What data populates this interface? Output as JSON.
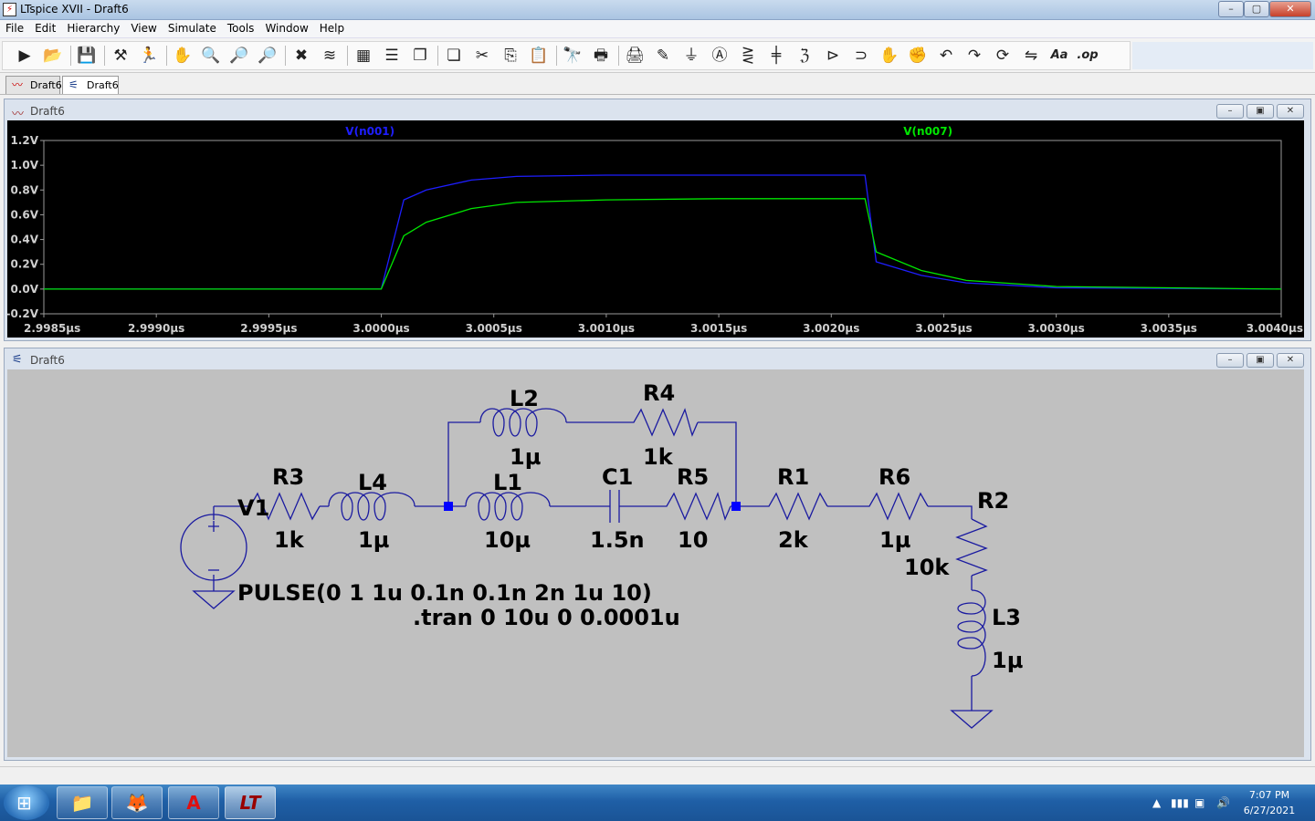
{
  "app": {
    "title": "LTspice XVII - Draft6"
  },
  "window_controls": {
    "minimize": "–",
    "maximize": "▢",
    "close": "✕"
  },
  "menu": [
    "File",
    "Edit",
    "Hierarchy",
    "View",
    "Simulate",
    "Tools",
    "Window",
    "Help"
  ],
  "toolbar": {
    "buttons": [
      {
        "name": "run-icon",
        "glyph": "▶"
      },
      {
        "name": "open-icon",
        "glyph": "📂"
      },
      {
        "name": "save-icon",
        "glyph": "💾"
      },
      {
        "name": "control-panel-icon",
        "glyph": "⚒"
      },
      {
        "name": "run-probe-icon",
        "glyph": "🏃"
      },
      {
        "name": "pan-hand-icon",
        "glyph": "✋"
      },
      {
        "name": "zoom-in-icon",
        "glyph": "🔍"
      },
      {
        "name": "zoom-area-icon",
        "glyph": "🔎"
      },
      {
        "name": "zoom-out-icon",
        "glyph": "🔎"
      },
      {
        "name": "zoom-fit-icon",
        "glyph": "✖"
      },
      {
        "name": "autorange-icon",
        "glyph": "≋"
      },
      {
        "name": "grid-icon",
        "glyph": "▦"
      },
      {
        "name": "tile-horizontal-icon",
        "glyph": "☰"
      },
      {
        "name": "cascade-icon",
        "glyph": "❐"
      },
      {
        "name": "tile-vertical-icon",
        "glyph": "❏"
      },
      {
        "name": "cut-icon",
        "glyph": "✂"
      },
      {
        "name": "copy-icon",
        "glyph": "⎘"
      },
      {
        "name": "paste-icon",
        "glyph": "📋"
      },
      {
        "name": "find-icon",
        "glyph": "🔭"
      },
      {
        "name": "print-icon",
        "glyph": "🖶"
      },
      {
        "name": "print-setup-icon",
        "glyph": "🖨"
      },
      {
        "name": "draw-wire-icon",
        "glyph": "✎"
      },
      {
        "name": "ground-icon",
        "glyph": "⏚"
      },
      {
        "name": "label-net-icon",
        "glyph": "Ⓐ"
      },
      {
        "name": "resistor-icon",
        "glyph": "⋛"
      },
      {
        "name": "capacitor-icon",
        "glyph": "╪"
      },
      {
        "name": "inductor-icon",
        "glyph": "ℨ"
      },
      {
        "name": "diode-icon",
        "glyph": "⊳"
      },
      {
        "name": "component-icon",
        "glyph": "⊃"
      },
      {
        "name": "move-icon",
        "glyph": "✋"
      },
      {
        "name": "drag-icon",
        "glyph": "✊"
      },
      {
        "name": "undo-icon",
        "glyph": "↶"
      },
      {
        "name": "redo-icon",
        "glyph": "↷"
      },
      {
        "name": "rotate-icon",
        "glyph": "⟳"
      },
      {
        "name": "mirror-icon",
        "glyph": "⇋"
      },
      {
        "name": "text-icon",
        "glyph": "Aa"
      },
      {
        "name": "spice-directive-icon",
        "glyph": ".op"
      }
    ]
  },
  "tabs": [
    {
      "label": "Draft6",
      "icon": "waveform-icon",
      "active": false
    },
    {
      "label": "Draft6",
      "icon": "schematic-icon",
      "active": true
    }
  ],
  "plot_window": {
    "title": "Draft6",
    "trace_labels": [
      {
        "text": "V(n001)",
        "color": "#1e1eff"
      },
      {
        "text": "V(n007)",
        "color": "#00e600"
      }
    ]
  },
  "chart_data": {
    "type": "line",
    "title": "",
    "xlabel": "",
    "ylabel": "",
    "xlim": [
      2.9985,
      3.004
    ],
    "ylim": [
      -0.2,
      1.2
    ],
    "grid": false,
    "legend": "top",
    "x_ticks": [
      "2.9985µs",
      "2.9990µs",
      "2.9995µs",
      "3.0000µs",
      "3.0005µs",
      "3.0010µs",
      "3.0015µs",
      "3.0020µs",
      "3.0025µs",
      "3.0030µs",
      "3.0035µs",
      "3.0040µs"
    ],
    "y_ticks": [
      "1.2V",
      "1.0V",
      "0.8V",
      "0.6V",
      "0.4V",
      "0.2V",
      "0.0V",
      "-0.2V"
    ],
    "y_tick_values": [
      1.2,
      1.0,
      0.8,
      0.6,
      0.4,
      0.2,
      0.0,
      -0.2
    ],
    "series": [
      {
        "name": "V(n001)",
        "color": "#1e1eff",
        "x": [
          2.9985,
          3.0,
          3.0001,
          3.0002,
          3.0004,
          3.0006,
          3.001,
          3.0015,
          3.0021,
          3.00215,
          3.0022,
          3.0024,
          3.0026,
          3.003,
          3.004
        ],
        "y": [
          0.0,
          0.0,
          0.72,
          0.8,
          0.88,
          0.91,
          0.92,
          0.92,
          0.92,
          0.92,
          0.22,
          0.11,
          0.05,
          0.01,
          0.0
        ]
      },
      {
        "name": "V(n007)",
        "color": "#00e600",
        "x": [
          2.9985,
          3.0,
          3.0001,
          3.0002,
          3.0004,
          3.0006,
          3.001,
          3.0015,
          3.0021,
          3.00215,
          3.0022,
          3.0024,
          3.0026,
          3.003,
          3.004
        ],
        "y": [
          0.0,
          0.0,
          0.43,
          0.54,
          0.65,
          0.7,
          0.72,
          0.73,
          0.73,
          0.73,
          0.3,
          0.15,
          0.07,
          0.02,
          0.0
        ]
      }
    ]
  },
  "schematic_window": {
    "title": "Draft6",
    "components": [
      {
        "ref": "V1",
        "value": ""
      },
      {
        "ref": "R3",
        "value": "1k"
      },
      {
        "ref": "L4",
        "value": "1µ"
      },
      {
        "ref": "L2",
        "value": "1µ"
      },
      {
        "ref": "R4",
        "value": "1k"
      },
      {
        "ref": "L1",
        "value": "10µ"
      },
      {
        "ref": "C1",
        "value": "1.5n"
      },
      {
        "ref": "R5",
        "value": "10"
      },
      {
        "ref": "R1",
        "value": "2k"
      },
      {
        "ref": "R6",
        "value": "1µ"
      },
      {
        "ref": "R2",
        "value": "10k"
      },
      {
        "ref": "L3",
        "value": "1µ"
      }
    ],
    "source_directive": "PULSE(0 1 1u 0.1n 0.1n 2n 1u 10)",
    "sim_directive": ".tran 0 10u 0 0.0001u"
  },
  "taskbar": {
    "apps": [
      {
        "name": "file-explorer-icon",
        "glyph": "📁"
      },
      {
        "name": "firefox-icon",
        "glyph": "🦊"
      },
      {
        "name": "acrobat-icon",
        "glyph": "A"
      },
      {
        "name": "ltspice-icon",
        "glyph": "LT"
      }
    ],
    "clock_time": "7:07 PM",
    "clock_date": "6/27/2021"
  }
}
